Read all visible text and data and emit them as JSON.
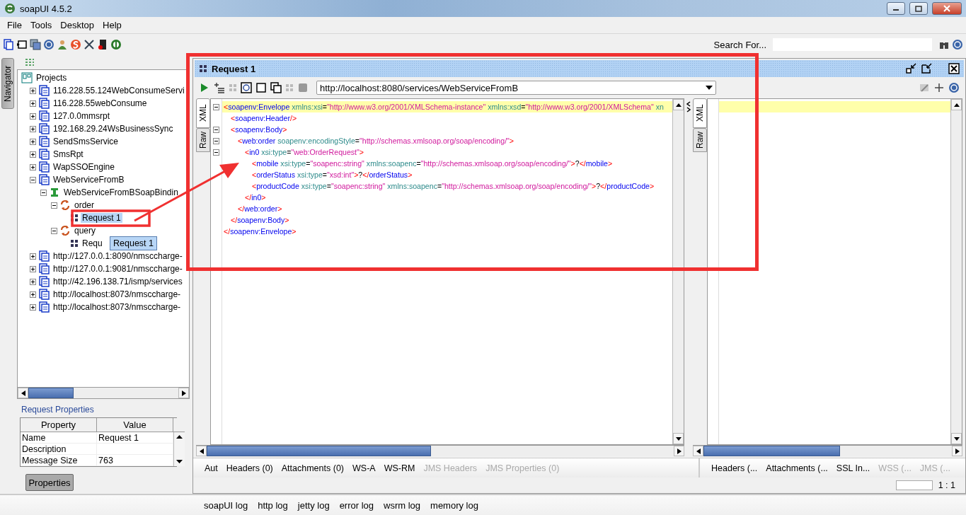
{
  "window": {
    "title": "soapUI 4.5.2"
  },
  "menu": [
    "File",
    "Tools",
    "Desktop",
    "Help"
  ],
  "search": {
    "label": "Search For..."
  },
  "navigator": {
    "tab": "Navigator",
    "tree": {
      "label": "Projects",
      "kind": "root",
      "children": [
        {
          "label": "116.228.55.124WebConsumeServi",
          "kind": "project",
          "expanded": false,
          "selected": false
        },
        {
          "label": "116.228.55webConsume",
          "kind": "project",
          "expanded": false,
          "selected": false
        },
        {
          "label": "127.0.0mmsrpt",
          "kind": "project",
          "expanded": false,
          "selected": false
        },
        {
          "label": "192.168.29.24WsBusinessSync",
          "kind": "project",
          "expanded": false,
          "selected": false
        },
        {
          "label": "SendSmsService",
          "kind": "project",
          "expanded": false,
          "selected": false
        },
        {
          "label": "SmsRpt",
          "kind": "project",
          "expanded": false,
          "selected": false
        },
        {
          "label": "WapSSOEngine",
          "kind": "project",
          "expanded": false,
          "selected": false
        },
        {
          "label": "WebServiceFromB",
          "kind": "project",
          "expanded": true,
          "selected": false,
          "children": [
            {
              "label": "WebServiceFromBSoapBindin",
              "kind": "interface",
              "expanded": true,
              "selected": false,
              "children": [
                {
                  "label": "order",
                  "kind": "operation",
                  "expanded": true,
                  "selected": false,
                  "children": [
                    {
                      "label": "Request 1",
                      "kind": "request",
                      "selected": true
                    }
                  ]
                },
                {
                  "label": "query",
                  "kind": "operation",
                  "expanded": true,
                  "selected": false,
                  "children": [
                    {
                      "label": "Requ",
                      "kind": "request",
                      "selected": false
                    }
                  ]
                }
              ]
            }
          ]
        },
        {
          "label": "http://127.0.0.1:8090/nmsccharge-",
          "kind": "project",
          "expanded": false,
          "selected": false
        },
        {
          "label": "http://127.0.0.1:9081/nmsccharge-",
          "kind": "project",
          "expanded": false,
          "selected": false
        },
        {
          "label": "http://42.196.138.71/ismp/services",
          "kind": "project",
          "expanded": false,
          "selected": false
        },
        {
          "label": "http://localhost:8073/nmsccharge-",
          "kind": "project",
          "expanded": false,
          "selected": false
        },
        {
          "label": "http://localhost:8073/nmsccharge-",
          "kind": "project",
          "expanded": false,
          "selected": false
        }
      ]
    }
  },
  "tooltip": "Request 1",
  "properties": {
    "title": "Request Properties",
    "columns": [
      "Property",
      "Value"
    ],
    "rows": [
      {
        "property": "Name",
        "value": "Request 1"
      },
      {
        "property": "Description"
      },
      {
        "property": "Message Size",
        "value": "763"
      }
    ],
    "button": "Properties"
  },
  "editor": {
    "title": "Request 1",
    "endpoint": "http://localhost:8080/services/WebServiceFromB",
    "request_tabs": [
      {
        "label": "XML",
        "selected": true
      },
      {
        "label": "Raw",
        "selected": false
      }
    ],
    "xml": {
      "current": true,
      "open": [
        {
          "kind": "punct",
          "text": "<"
        },
        {
          "kind": "tag",
          "text": "soapenv:Envelope"
        },
        {
          "kind": "attr",
          "text": " xmlns:xsi"
        },
        {
          "kind": "plain",
          "text": "="
        },
        {
          "kind": "value",
          "text": "\"http://www.w3.org/2001/XMLSchema-instance\""
        },
        {
          "kind": "attr",
          "text": " xmlns:xsd"
        },
        {
          "kind": "plain",
          "text": "="
        },
        {
          "kind": "value",
          "text": "\"http://www.w3.org/2001/XMLSchema\""
        },
        {
          "kind": "attr",
          "text": " xn"
        }
      ],
      "children": [
        {
          "open": [
            {
              "kind": "punct",
              "text": "<"
            },
            {
              "kind": "tag",
              "text": "soapenv:Header"
            },
            {
              "kind": "punct",
              "text": "/>"
            }
          ]
        },
        {
          "open": [
            {
              "kind": "punct",
              "text": "<"
            },
            {
              "kind": "tag",
              "text": "soapenv:Body"
            },
            {
              "kind": "punct",
              "text": ">"
            }
          ],
          "close": [
            {
              "kind": "punct",
              "text": "</"
            },
            {
              "kind": "tag",
              "text": "soapenv:Body"
            },
            {
              "kind": "punct",
              "text": ">"
            }
          ],
          "children": [
            {
              "open": [
                {
                  "kind": "punct",
                  "text": "<"
                },
                {
                  "kind": "tag",
                  "text": "web:order"
                },
                {
                  "kind": "attr",
                  "text": " soapenv:encodingStyle"
                },
                {
                  "kind": "plain",
                  "text": "="
                },
                {
                  "kind": "value",
                  "text": "\"http://schemas.xmlsoap.org/soap/encoding/\""
                },
                {
                  "kind": "punct",
                  "text": ">"
                }
              ],
              "close": [
                {
                  "kind": "punct",
                  "text": "</"
                },
                {
                  "kind": "tag",
                  "text": "web:order"
                },
                {
                  "kind": "punct",
                  "text": ">"
                }
              ],
              "children": [
                {
                  "open": [
                    {
                      "kind": "punct",
                      "text": "<"
                    },
                    {
                      "kind": "tag",
                      "text": "in0"
                    },
                    {
                      "kind": "attr",
                      "text": " xsi:type"
                    },
                    {
                      "kind": "plain",
                      "text": "="
                    },
                    {
                      "kind": "value",
                      "text": "\"web:OrderRequest\""
                    },
                    {
                      "kind": "punct",
                      "text": ">"
                    }
                  ],
                  "close": [
                    {
                      "kind": "punct",
                      "text": "</"
                    },
                    {
                      "kind": "tag",
                      "text": "in0"
                    },
                    {
                      "kind": "punct",
                      "text": ">"
                    }
                  ],
                  "children": [
                    {
                      "open": [
                        {
                          "kind": "punct",
                          "text": "<"
                        },
                        {
                          "kind": "tag",
                          "text": "mobile"
                        },
                        {
                          "kind": "attr",
                          "text": " xsi:type"
                        },
                        {
                          "kind": "plain",
                          "text": "="
                        },
                        {
                          "kind": "value",
                          "text": "\"soapenc:string\""
                        },
                        {
                          "kind": "attr",
                          "text": " xmlns:soapenc"
                        },
                        {
                          "kind": "plain",
                          "text": "="
                        },
                        {
                          "kind": "value",
                          "text": "\"http://schemas.xmlsoap.org/soap/encoding/\""
                        },
                        {
                          "kind": "punct",
                          "text": ">"
                        },
                        {
                          "kind": "plain",
                          "text": "?"
                        },
                        {
                          "kind": "punct",
                          "text": "</"
                        },
                        {
                          "kind": "tag",
                          "text": "mobile"
                        },
                        {
                          "kind": "punct",
                          "text": ">"
                        }
                      ]
                    },
                    {
                      "open": [
                        {
                          "kind": "punct",
                          "text": "<"
                        },
                        {
                          "kind": "tag",
                          "text": "orderStatus"
                        },
                        {
                          "kind": "attr",
                          "text": " xsi:type"
                        },
                        {
                          "kind": "plain",
                          "text": "="
                        },
                        {
                          "kind": "value",
                          "text": "\"xsd:int\""
                        },
                        {
                          "kind": "punct",
                          "text": ">"
                        },
                        {
                          "kind": "plain",
                          "text": "?"
                        },
                        {
                          "kind": "punct",
                          "text": "</"
                        },
                        {
                          "kind": "tag",
                          "text": "orderStatus"
                        },
                        {
                          "kind": "punct",
                          "text": ">"
                        }
                      ]
                    },
                    {
                      "open": [
                        {
                          "kind": "punct",
                          "text": "<"
                        },
                        {
                          "kind": "tag",
                          "text": "productCode"
                        },
                        {
                          "kind": "attr",
                          "text": " xsi:type"
                        },
                        {
                          "kind": "plain",
                          "text": "="
                        },
                        {
                          "kind": "value",
                          "text": "\"soapenc:string\""
                        },
                        {
                          "kind": "attr",
                          "text": " xmlns:soapenc"
                        },
                        {
                          "kind": "plain",
                          "text": "="
                        },
                        {
                          "kind": "value",
                          "text": "\"http://schemas.xmlsoap.org/soap/encoding/\""
                        },
                        {
                          "kind": "punct",
                          "text": ">"
                        },
                        {
                          "kind": "plain",
                          "text": "?"
                        },
                        {
                          "kind": "punct",
                          "text": "</"
                        },
                        {
                          "kind": "tag",
                          "text": "productCode"
                        },
                        {
                          "kind": "punct",
                          "text": ">"
                        }
                      ]
                    }
                  ]
                }
              ]
            }
          ]
        }
      ],
      "close": [
        {
          "kind": "punct",
          "text": "</"
        },
        {
          "kind": "tag",
          "text": "soapenv:Envelope"
        },
        {
          "kind": "punct",
          "text": ">"
        }
      ]
    },
    "request_bottom_tabs": [
      {
        "label": "Aut",
        "disabled": false
      },
      {
        "label": "Headers (0)",
        "disabled": false
      },
      {
        "label": "Attachments (0)",
        "disabled": false
      },
      {
        "label": "WS-A",
        "disabled": false
      },
      {
        "label": "WS-RM",
        "disabled": false
      },
      {
        "label": "JMS Headers",
        "disabled": true
      },
      {
        "label": "JMS Properties (0)",
        "disabled": true
      }
    ],
    "response_tabs": [
      {
        "label": "XML",
        "selected": true
      },
      {
        "label": "Raw",
        "selected": false
      }
    ],
    "response_bottom_tabs": [
      {
        "label": "Headers (...",
        "disabled": false
      },
      {
        "label": "Attachments (...",
        "disabled": false
      },
      {
        "label": "SSL In...",
        "disabled": false
      },
      {
        "label": "WSS (...",
        "disabled": true
      },
      {
        "label": "JMS (...",
        "disabled": true
      }
    ],
    "position": "1 : 1"
  },
  "log_tabs": [
    "soapUI log",
    "http log",
    "jetty log",
    "error log",
    "wsrm log",
    "memory log"
  ]
}
